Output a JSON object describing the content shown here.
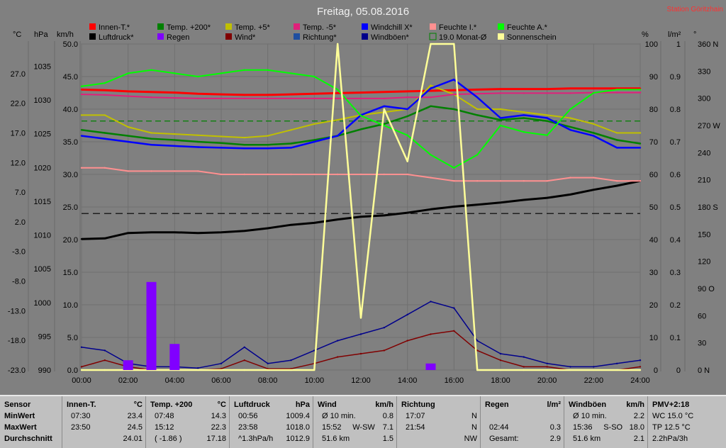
{
  "title": "Freitag, 05.08.2016",
  "station": "Station Göritzhain",
  "colors": {
    "bg": "#808080",
    "plot_bg": "#808080",
    "grid": "#707070",
    "innen": "#ff0000",
    "luftdruck": "#000000",
    "temp200": "#008000",
    "regen": "#8000ff",
    "temp5": "#c0c000",
    "wind": "#800000",
    "temp_5": "#e0207a",
    "richtung": "#1f4fa0",
    "windchill": "#0000ff",
    "windboeen": "#00008b",
    "feuchte_i": "#ff9090",
    "feuchte_a": "#00ff00",
    "sonne": "#ffff99",
    "monat": "#008000"
  },
  "axis_units": {
    "c": "°C",
    "hpa": "hPa",
    "kmh": "km/h",
    "pct": "%",
    "lm2": "l/m²",
    "deg": "°"
  },
  "chart_data": {
    "type": "line",
    "title": "Freitag, 05.08.2016",
    "x": [
      "00:00",
      "01:00",
      "02:00",
      "03:00",
      "04:00",
      "05:00",
      "06:00",
      "07:00",
      "08:00",
      "09:00",
      "10:00",
      "11:00",
      "12:00",
      "13:00",
      "14:00",
      "15:00",
      "16:00",
      "17:00",
      "18:00",
      "19:00",
      "20:00",
      "21:00",
      "22:00",
      "23:00",
      "24:00"
    ],
    "xticks": [
      "00:00",
      "02:00",
      "04:00",
      "06:00",
      "08:00",
      "10:00",
      "12:00",
      "14:00",
      "16:00",
      "18:00",
      "20:00",
      "22:00",
      "24:00"
    ],
    "axes": {
      "temp_c": {
        "ticks": [
          "27.0",
          "22.0",
          "17.0",
          "12.0",
          "7.0",
          "2.0",
          "-3.0",
          "-8.0",
          "-13.0",
          "-18.0",
          "-23.0"
        ],
        "ylim": [
          -23,
          32
        ]
      },
      "pressure_hpa": {
        "ticks": [
          "1035",
          "1030",
          "1025",
          "1020",
          "1015",
          "1010",
          "1005",
          "1000",
          "995",
          "990"
        ],
        "ylim": [
          990,
          1038.3
        ]
      },
      "speed_kmh": {
        "ticks": [
          "50.0",
          "45.0",
          "40.0",
          "35.0",
          "30.0",
          "25.0",
          "20.0",
          "15.0",
          "10.0",
          "5.0",
          "0.0"
        ],
        "ylim": [
          0,
          50
        ]
      },
      "humidity_pct": {
        "ticks": [
          "100",
          "90",
          "80",
          "70",
          "60",
          "50",
          "40",
          "30",
          "20",
          "10",
          "0"
        ],
        "ylim": [
          0,
          100
        ]
      },
      "rain_lm2": {
        "ticks": [
          "1",
          "0.9",
          "0.8",
          "0.7",
          "0.6",
          "0.5",
          "0.4",
          "0.3",
          "0.2",
          "0.1",
          "0"
        ],
        "ylim": [
          0,
          1
        ]
      },
      "direction_deg": {
        "ticks": [
          "360 N",
          "330",
          "300",
          "270 W",
          "240",
          "210",
          "180 S",
          "150",
          "120",
          "90 O",
          "60",
          "30",
          "0 N"
        ],
        "ylim": [
          0,
          360
        ]
      }
    },
    "legend": [
      {
        "name": "Innen-T.*",
        "color": "#ff0000"
      },
      {
        "name": "Luftdruck*",
        "color": "#000000"
      },
      {
        "name": "Temp. +200*",
        "color": "#008000"
      },
      {
        "name": "Regen",
        "color": "#8000ff"
      },
      {
        "name": "Temp. +5*",
        "color": "#c0c000"
      },
      {
        "name": "Wind*",
        "color": "#800000"
      },
      {
        "name": "Temp. -5*",
        "color": "#e0207a"
      },
      {
        "name": "Richtung*",
        "color": "#1f4fa0"
      },
      {
        "name": "Windchill X*",
        "color": "#0000ff"
      },
      {
        "name": "Windböen*",
        "color": "#00008b"
      },
      {
        "name": "Feuchte I.*",
        "color": "#ff9090"
      },
      {
        "name": "19.0 Monat-Ø",
        "color": "#008000"
      },
      {
        "name": "Feuchte A.*",
        "color": "#00ff00"
      },
      {
        "name": "Sonnenschein",
        "color": "#ffff99"
      }
    ],
    "series": [
      {
        "name": "Innen-T.*",
        "axis": "temp_c",
        "values": [
          24.3,
          24.2,
          24.0,
          23.9,
          23.8,
          23.6,
          23.5,
          23.4,
          23.4,
          23.5,
          23.6,
          23.7,
          23.8,
          23.9,
          24.0,
          24.1,
          24.2,
          24.3,
          24.4,
          24.4,
          24.4,
          24.5,
          24.5,
          24.5,
          24.5
        ]
      },
      {
        "name": "Temp. +200*",
        "axis": "temp_c",
        "values": [
          17.5,
          17.0,
          16.5,
          16.0,
          15.8,
          15.5,
          15.3,
          15.0,
          15.0,
          15.2,
          15.8,
          16.5,
          17.6,
          18.5,
          19.8,
          21.5,
          21.0,
          20.0,
          19.2,
          19.5,
          19.0,
          18.0,
          17.0,
          15.8,
          15.2
        ]
      },
      {
        "name": "Temp. +5*",
        "axis": "temp_c",
        "values": [
          20.0,
          20.0,
          18.0,
          17.0,
          16.8,
          16.6,
          16.4,
          16.2,
          16.5,
          17.5,
          18.5,
          19.2,
          20.0,
          20.5,
          21.0,
          25.0,
          23.5,
          21.0,
          21.0,
          20.5,
          20.0,
          19.5,
          18.5,
          17.0,
          17.0
        ]
      },
      {
        "name": "Temp. -5*",
        "axis": "temp_c",
        "values": [
          23.5,
          23.4,
          23.2,
          23.0,
          22.9,
          22.8,
          22.8,
          22.8,
          22.8,
          22.8,
          22.8,
          22.8,
          22.8,
          22.8,
          23.0,
          23.0,
          23.5,
          23.6,
          23.7,
          23.7,
          23.7,
          23.7,
          23.8,
          23.8,
          23.8
        ]
      },
      {
        "name": "Windchill X*",
        "axis": "temp_c",
        "values": [
          16.5,
          16.0,
          15.5,
          15.0,
          14.8,
          14.6,
          14.5,
          14.4,
          14.4,
          14.5,
          15.5,
          16.5,
          20.0,
          21.5,
          21.0,
          24.5,
          26.0,
          23.0,
          19.5,
          20.0,
          19.5,
          17.5,
          16.5,
          14.5,
          14.5
        ]
      },
      {
        "name": "Luftdruck*",
        "axis": "pressure_hpa",
        "values": [
          1009.4,
          1009.5,
          1010.3,
          1010.4,
          1010.4,
          1010.3,
          1010.4,
          1010.6,
          1011.0,
          1011.5,
          1011.8,
          1012.3,
          1012.7,
          1012.9,
          1013.3,
          1013.8,
          1014.2,
          1014.5,
          1014.8,
          1015.2,
          1015.5,
          1016.0,
          1016.7,
          1017.3,
          1018.0
        ]
      },
      {
        "name": "Feuchte I.*",
        "axis": "humidity_pct",
        "values": [
          62,
          62,
          61,
          61,
          61,
          61,
          60,
          60,
          60,
          60,
          60,
          60,
          60,
          60,
          60,
          59,
          58,
          58,
          58,
          58,
          58,
          59,
          59,
          58,
          58
        ]
      },
      {
        "name": "Feuchte A.*",
        "axis": "humidity_pct",
        "values": [
          87,
          88,
          91,
          92,
          91,
          90,
          91,
          92,
          92,
          91,
          90,
          86,
          78,
          75,
          72,
          66,
          62,
          66,
          75,
          73,
          72,
          80,
          85,
          86,
          86
        ]
      },
      {
        "name": "Wind*",
        "axis": "speed_kmh",
        "values": [
          0.5,
          1.5,
          0.5,
          0.0,
          0.0,
          0.0,
          0.2,
          1.5,
          0.2,
          0.2,
          1.0,
          2.0,
          2.5,
          3.0,
          4.5,
          5.5,
          6.0,
          3.0,
          1.5,
          0.5,
          0.5,
          0.0,
          0.0,
          0.0,
          0.5
        ]
      },
      {
        "name": "Windböen*",
        "axis": "speed_kmh",
        "values": [
          3.5,
          3.0,
          1.0,
          0.5,
          0.5,
          0.3,
          1.0,
          3.5,
          1.0,
          1.5,
          3.0,
          4.5,
          5.5,
          6.5,
          8.5,
          10.5,
          9.5,
          4.5,
          2.5,
          2.0,
          1.0,
          0.5,
          0.5,
          1.0,
          1.5
        ]
      },
      {
        "name": "Sonnenschein",
        "axis": "speed_kmh",
        "values": [
          0,
          0,
          0,
          0,
          0,
          0,
          0,
          0,
          0,
          0,
          0,
          50,
          8,
          40,
          32,
          50,
          50,
          0,
          0,
          0,
          0,
          0,
          0,
          0,
          0
        ]
      },
      {
        "name": "Regen",
        "axis": "rain_lm2",
        "values": [
          0,
          0,
          0.03,
          0.27,
          0.08,
          0,
          0,
          0,
          0,
          0,
          0,
          0,
          0,
          0,
          0,
          0.02,
          0,
          0,
          0,
          0,
          0,
          0,
          0,
          0,
          0
        ]
      }
    ],
    "reference_lines": [
      {
        "name": "19.0 Monat-Ø",
        "axis": "temp_c",
        "value": 19.0
      },
      {
        "axis": "speed_kmh",
        "value": 24.0
      }
    ]
  },
  "stats": {
    "headers": {
      "sensor": "Sensor",
      "innen": "Innen-T.",
      "innen_u": "°C",
      "temp": "Temp. +200",
      "temp_u": "°C",
      "druck": "Luftdruck",
      "druck_u": "hPa",
      "wind": "Wind",
      "wind_u": "km/h",
      "richtung": "Richtung",
      "regen": "Regen",
      "regen_u": "l/m²",
      "boeen": "Windböen",
      "boeen_u": "km/h",
      "pmv": "PMV+2:18"
    },
    "rowlabels": [
      "MinWert",
      "MaxWert",
      "Durchschnitt"
    ],
    "innen": [
      [
        "07:30",
        "23.4"
      ],
      [
        "23:50",
        "24.5"
      ],
      [
        "",
        "24.01"
      ]
    ],
    "temp": [
      [
        "07:48",
        "14.3"
      ],
      [
        "15:12",
        "22.3"
      ],
      [
        "( -1.86 )",
        "17.18"
      ]
    ],
    "druck": [
      [
        "00:56",
        "1009.4"
      ],
      [
        "23:58",
        "1018.0"
      ],
      [
        "^1.3hPa/h",
        "1012.9"
      ]
    ],
    "wind": [
      [
        "Ø 10 min.",
        "",
        "0.8"
      ],
      [
        "15:52",
        "W-SW",
        "7.1"
      ],
      [
        "51.6 km",
        "",
        "1.5"
      ]
    ],
    "richtung": [
      [
        "17:07",
        "N"
      ],
      [
        "21:54",
        "N"
      ],
      [
        "",
        "NW"
      ]
    ],
    "regen": [
      [
        "",
        ""
      ],
      [
        "02:44",
        "0.3"
      ],
      [
        "Gesamt:",
        "2.9"
      ]
    ],
    "boeen": [
      [
        "Ø 10 min.",
        "",
        "2.2"
      ],
      [
        "15:36",
        "S-SO",
        "18.0"
      ],
      [
        "51.6 km",
        "",
        "2.1"
      ]
    ],
    "pmv": [
      "WC 15.0 °C",
      "TP 12.5 °C",
      "2.2hPa/3h"
    ]
  }
}
